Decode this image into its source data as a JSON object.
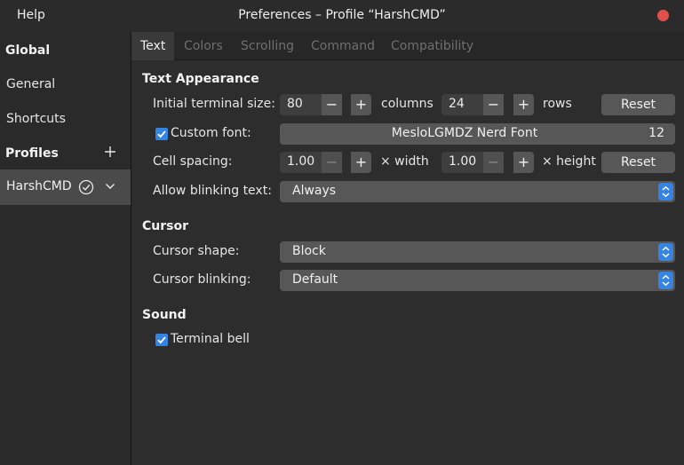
{
  "titlebar": {
    "menu_help": "Help",
    "title": "Preferences – Profile “HarshCMD”"
  },
  "sidebar": {
    "global_heading": "Global",
    "items": [
      {
        "label": "General"
      },
      {
        "label": "Shortcuts"
      }
    ],
    "profiles_heading": "Profiles",
    "profile": {
      "label": "HarshCMD",
      "is_default": true
    }
  },
  "tabs": [
    {
      "label": "Text",
      "active": true
    },
    {
      "label": "Colors"
    },
    {
      "label": "Scrolling"
    },
    {
      "label": "Command"
    },
    {
      "label": "Compatibility"
    }
  ],
  "text_appearance": {
    "heading": "Text Appearance",
    "initial_size_label": "Initial terminal size:",
    "columns_value": "80",
    "columns_unit": "columns",
    "rows_value": "24",
    "rows_unit": "rows",
    "reset_label": "Reset",
    "custom_font_label": "Custom font:",
    "custom_font_checked": true,
    "font_name": "MesloLGMDZ Nerd Font",
    "font_size": "12",
    "cell_spacing_label": "Cell spacing:",
    "width_value": "1.00",
    "width_unit": "× width",
    "height_value": "1.00",
    "height_unit": "× height",
    "reset2_label": "Reset",
    "blink_text_label": "Allow blinking text:",
    "blink_text_value": "Always"
  },
  "cursor": {
    "heading": "Cursor",
    "shape_label": "Cursor shape:",
    "shape_value": "Block",
    "blinking_label": "Cursor blinking:",
    "blinking_value": "Default"
  },
  "sound": {
    "heading": "Sound",
    "bell_label": "Terminal bell",
    "bell_checked": true
  },
  "glyphs": {
    "minus": "−",
    "plus": "+"
  },
  "colors": {
    "accent": "#3584e4",
    "close": "#e0504a"
  }
}
